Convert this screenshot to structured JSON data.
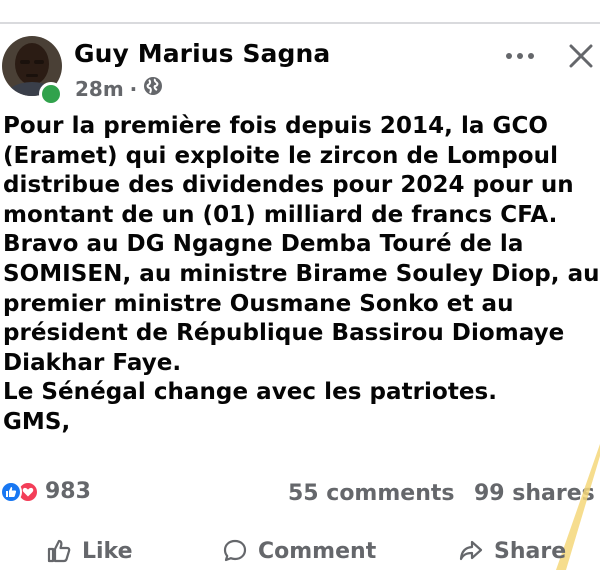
{
  "post": {
    "author": "Guy Marius Sagna",
    "time": "28m",
    "separator": "·",
    "icons": {
      "audience": "globe-icon",
      "more": "more-options-icon",
      "close": "close-icon"
    },
    "text_lines": [
      "Pour la première fois depuis 2014, la GCO",
      "(Eramet) qui exploite le zircon de Lompoul",
      "distribue des dividendes pour 2024 pour un",
      "montant de un (01) milliard de francs CFA.",
      "Bravo au DG Ngagne Demba Touré de la",
      "SOMISEN, au ministre Birame Souley Diop, au",
      "premier ministre Ousmane Sonko et au",
      "président de République Bassirou Diomaye",
      "Diakhar Faye.",
      "Le Sénégal change avec les patriotes.",
      "GMS,"
    ]
  },
  "stats": {
    "reactions": "983",
    "comments": "55 comments",
    "shares": "99 shares"
  },
  "actions": {
    "like": "Like",
    "comment": "Comment",
    "share": "Share"
  },
  "colors": {
    "text": "#050505",
    "secondary": "#65676b",
    "like_blue": "#1877f2",
    "love_red": "#f33e58",
    "online_green": "#31a24c",
    "divider": "#d9dadd"
  }
}
